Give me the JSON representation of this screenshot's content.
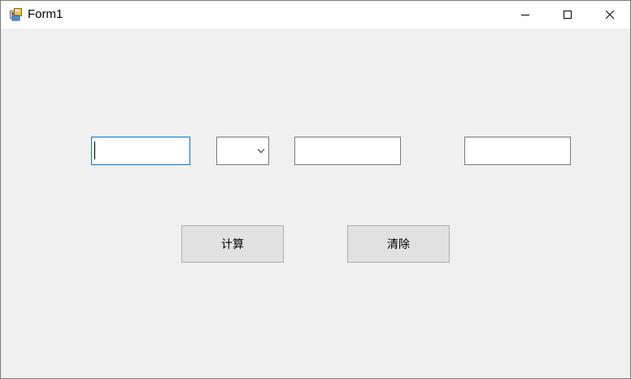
{
  "window": {
    "title": "Form1"
  },
  "form": {
    "input1_value": "",
    "operator_selected": "",
    "input2_value": "",
    "result_value": "",
    "calculate_label": "计算",
    "clear_label": "清除"
  },
  "colors": {
    "client_background": "#f0f0f0",
    "focus_border": "#0078d7",
    "button_face": "#e1e1e1"
  }
}
